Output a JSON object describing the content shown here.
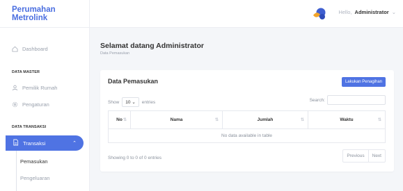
{
  "app": {
    "brand": "Perumahan Metrolink"
  },
  "sidebar": {
    "dashboard": "Dashboard",
    "section_master": "DATA MASTER",
    "pemilik_rumah": "Pemilik Rumah",
    "pengaturan": "Pengaturan",
    "section_transaksi": "DATA TRANSAKSI",
    "transaksi": "Transaksi",
    "pemasukan": "Pemasukan",
    "pengeluaran": "Pengeluaran"
  },
  "header": {
    "greeting": "Hello,",
    "username": "Administrator"
  },
  "page": {
    "title": "Selamat datang Administrator",
    "breadcrumb": "Data Pemasukan"
  },
  "card": {
    "title": "Data Pemasukan",
    "action_button": "Lakukan Penagihan",
    "show_label": "Show",
    "entries_value": "10",
    "entries_label": "entries",
    "search_label": "Search:",
    "columns": [
      "No",
      "Nama",
      "Jumlah",
      "Waktu"
    ],
    "empty_message": "No data available in table",
    "info": "Showing 0 to 0 of 0 entries",
    "prev": "Previous",
    "next": "Next"
  },
  "colors": {
    "accent": "#4f73e3",
    "brand": "#4a6ee0"
  }
}
